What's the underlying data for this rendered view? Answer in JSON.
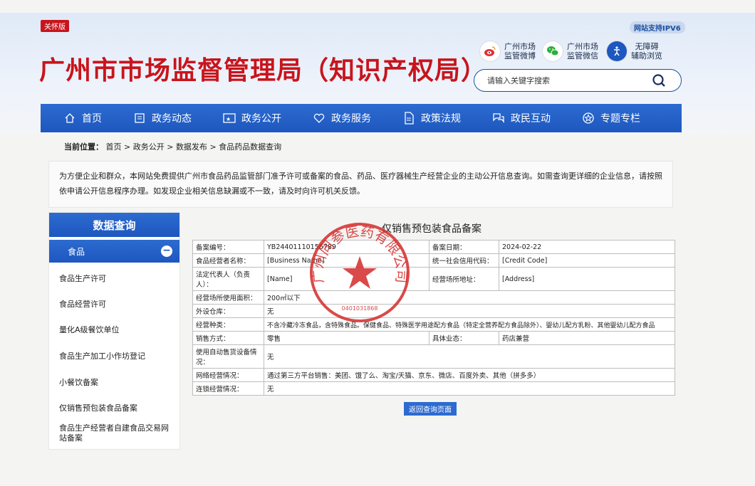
{
  "header": {
    "care_badge": "关怀版",
    "ipv6_badge": "网站支持IPV6",
    "site_title": "广州市市场监督管理局（知识产权局）",
    "quick_links": [
      {
        "icon": "weibo-icon",
        "label1": "广州市场",
        "label2": "监管微博"
      },
      {
        "icon": "wechat-icon",
        "label1": "广州市场",
        "label2": "监管微信"
      },
      {
        "icon": "accessibility-icon",
        "label1": "无障碍",
        "label2": "辅助浏览"
      }
    ],
    "search": {
      "placeholder": "请输入关键字搜索",
      "icon": "search-icon"
    }
  },
  "nav": {
    "items": [
      {
        "label": "首页",
        "icon": "home-icon"
      },
      {
        "label": "政务动态",
        "icon": "news-icon"
      },
      {
        "label": "政务公开",
        "icon": "open-icon"
      },
      {
        "label": "政务服务",
        "icon": "heart-icon"
      },
      {
        "label": "政策法规",
        "icon": "document-icon"
      },
      {
        "label": "政民互动",
        "icon": "chat-icon"
      },
      {
        "label": "专题专栏",
        "icon": "star-badge-icon"
      }
    ]
  },
  "breadcrumb": {
    "prefix": "当前位置：",
    "items": [
      "首页",
      "政务公开",
      "数据发布",
      "食品药品数据查询"
    ],
    "separator": ">"
  },
  "notice": {
    "text": "为方便企业和群众，本网站免费提供广州市食品药品监管部门准予许可或备案的食品、药品、医疗器械生产经营企业的主动公开信息查询。如需查询更详细的企业信息，请按照依申请公开信息程序办理。如发现企业相关信息缺漏或不一致，请及时向许可机关反馈。"
  },
  "sidebar": {
    "title": "数据查询",
    "active": {
      "label": "食品",
      "toggle": "−"
    },
    "items": [
      "食品生产许可",
      "食品经营许可",
      "量化A级餐饮单位",
      "食品生产加工小作坊登记",
      "小餐饮备案",
      "仅销售预包装食品备案",
      "食品生产经营者自建食品交易网站备案"
    ]
  },
  "record": {
    "title": "仅销售预包装食品备案",
    "rows": {
      "filing_no": {
        "label": "备案编号：",
        "value": "YB24401110156789"
      },
      "filing_date": {
        "label": "备案日期：",
        "value": "2024-02-22"
      },
      "operator_name": {
        "label": "食品经营者名称：",
        "value": "[Business Name]"
      },
      "credit_code": {
        "label": "统一社会信用代码：",
        "value": "[Credit Code]"
      },
      "legal_rep": {
        "label": "法定代表人（负责人）：",
        "value": "[Name]"
      },
      "address": {
        "label": "经营场所地址：",
        "value": "[Address]"
      },
      "area": {
        "label": "经营场所使用面积：",
        "value": "200㎡以下"
      },
      "warehouse": {
        "label": "外设仓库：",
        "value": "无"
      },
      "scope": {
        "label": "经营种类：",
        "value": "不含冷藏冷冻食品，含特殊食品。保健食品、特殊医学用途配方食品（特定全营养配方食品除外）、婴幼儿配方乳粉、其他婴幼儿配方食品"
      },
      "sales_mode": {
        "label": "销售方式：",
        "value": "零售"
      },
      "business_type": {
        "label": "具体业态：",
        "value": "药店兼营"
      },
      "vending": {
        "label": "使用自动售货设备情况：",
        "value": "无"
      },
      "online": {
        "label": "网络经营情况：",
        "value": "通过第三方平台销售：美团、饿了么、淘宝/天猫、京东、微店、百度外卖、其他（拼多多）"
      },
      "chain": {
        "label": "连锁经营情况：",
        "value": "无"
      }
    },
    "return_button": "返回查询页面"
  },
  "seal": {
    "text": "广州同参医药有限公司",
    "serial": "0401031868",
    "color": "#d42a2a"
  },
  "colors": {
    "brand_red": "#c8141c",
    "nav_blue": "#1d57bf"
  }
}
